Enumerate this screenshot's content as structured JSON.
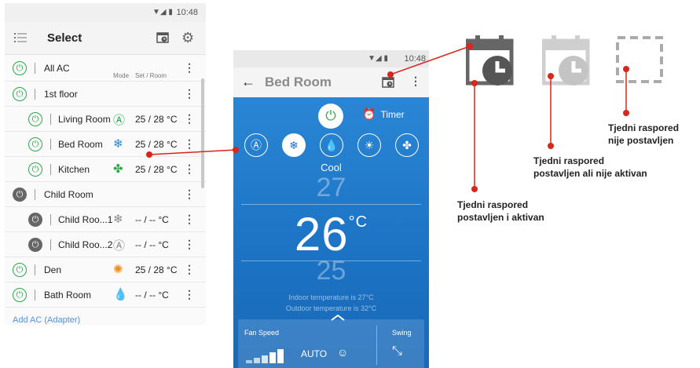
{
  "left_phone": {
    "status_time": "10:48",
    "title": "Select",
    "col_mode": "Mode",
    "col_set_room": "Set / Room",
    "add_ac": "Add AC (Adapter)",
    "rows": [
      {
        "name": "All AC",
        "power": "on",
        "indent": 0,
        "mode_icon": "",
        "value": ""
      },
      {
        "name": "1st floor",
        "power": "on",
        "indent": 0,
        "mode_icon": "",
        "value": ""
      },
      {
        "name": "Living Room",
        "power": "on",
        "indent": 1,
        "mode_icon": "auto-mode-icon",
        "value": "25 / 28 °C"
      },
      {
        "name": "Bed Room",
        "power": "on",
        "indent": 1,
        "mode_icon": "cool-mode-icon",
        "value": "25 / 28 °C"
      },
      {
        "name": "Kitchen",
        "power": "on",
        "indent": 1,
        "mode_icon": "fan-mode-icon",
        "value": "25 / 28 °C"
      },
      {
        "name": "Child Room",
        "power": "off",
        "indent": 0,
        "mode_icon": "",
        "value": ""
      },
      {
        "name": "Child Roo...1",
        "power": "off",
        "indent": 1,
        "mode_icon": "cool-mode-icon-off",
        "value": "-- / --  °C"
      },
      {
        "name": "Child Roo...2",
        "power": "off",
        "indent": 1,
        "mode_icon": "auto-mode-icon-off",
        "value": "-- / --  °C"
      },
      {
        "name": "Den",
        "power": "on",
        "indent": 0,
        "mode_icon": "heat-mode-icon",
        "value": "25 / 28 °C"
      },
      {
        "name": "Bath Room",
        "power": "on",
        "indent": 0,
        "mode_icon": "dry-mode-icon",
        "value": "-- / --  °C"
      }
    ]
  },
  "right_phone": {
    "status_time": "10:48",
    "title": "Bed Room",
    "timer_label": "Timer",
    "mode_label": "Cool",
    "temp_above": "27",
    "temp_set": "26",
    "temp_unit": "°C",
    "temp_below": "25",
    "indoor_text": "Indoor temperature is  27°C",
    "outdoor_text": "Outdoor temperature is  32°C",
    "fan_speed_label": "Fan Speed",
    "fan_value": "AUTO",
    "swing_label": "Swing"
  },
  "callouts": {
    "active": [
      "Tjedni raspored",
      "postavljen i aktivan"
    ],
    "inactive": [
      "Tjedni raspored",
      "postavljen ali nije aktivan"
    ],
    "not_set": [
      "Tjedni raspored",
      "nije postavljen"
    ]
  },
  "colors": {
    "accent_red": "#d9251c",
    "power_green": "#2aa84a",
    "blue": "#1f7bc9",
    "auto_icon": "#2aa84a",
    "cool_icon": "#2a86d5",
    "fan_icon": "#2aa84a",
    "heat_icon": "#f28c1e",
    "dry_icon": "#2a9ad5"
  }
}
